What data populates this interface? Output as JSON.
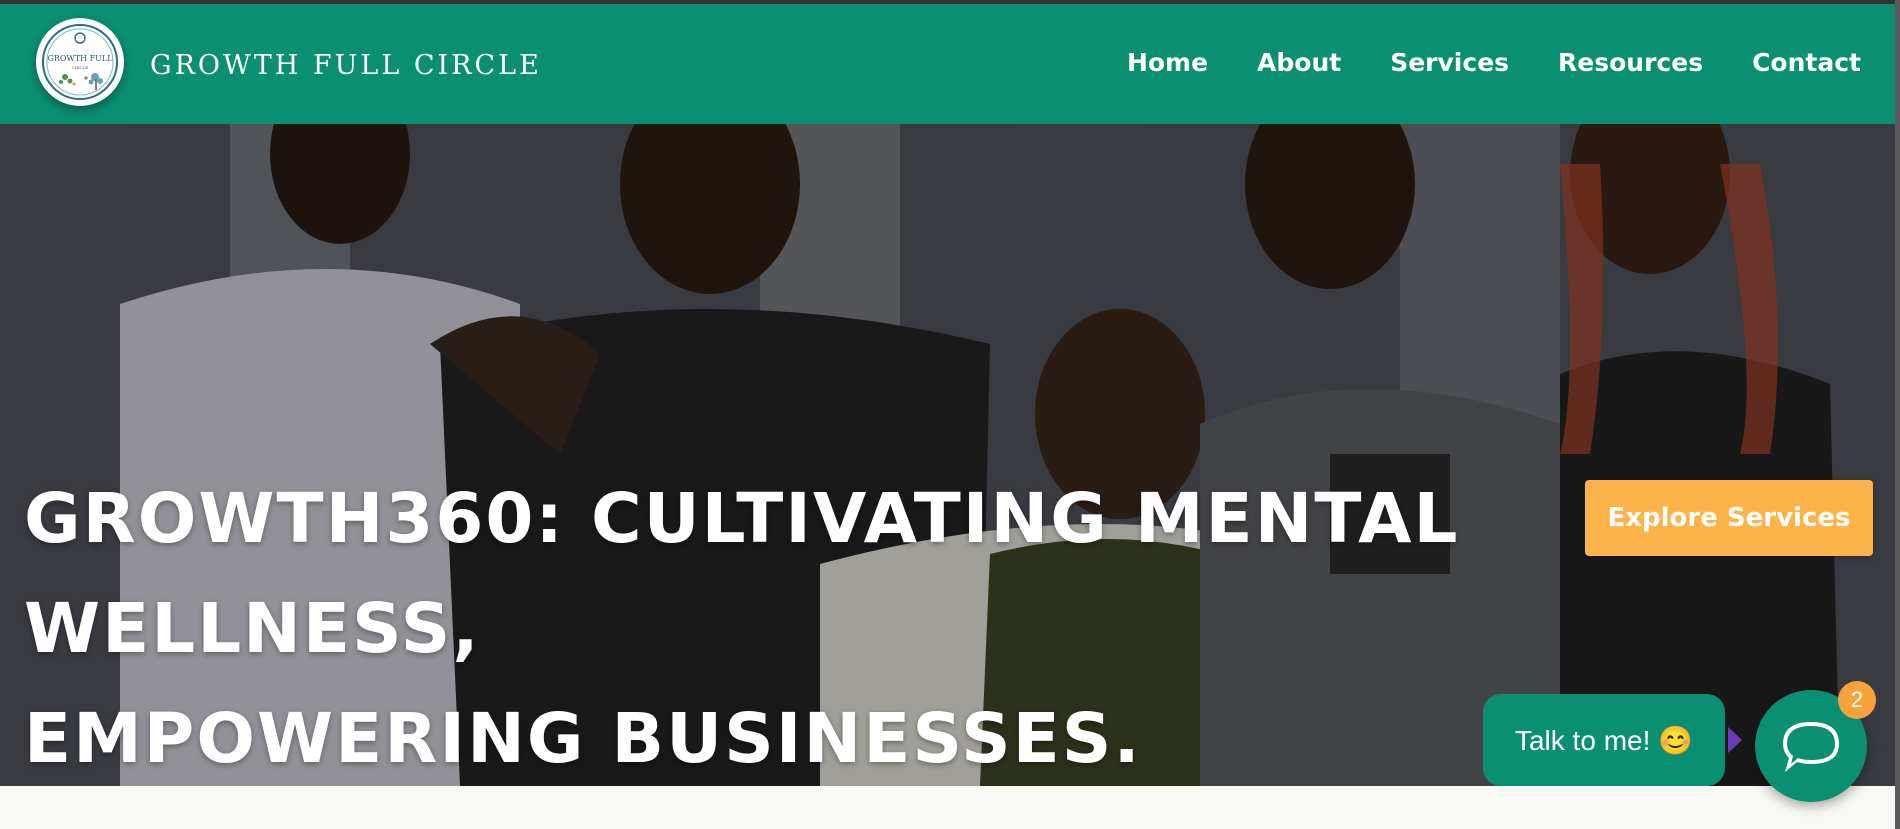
{
  "header": {
    "brand": "GROWTH FULL CIRCLE",
    "logo_icon": "growth-full-circle-logo",
    "logo_text": "GROWTH FULL",
    "logo_subtext": "CIRCLE",
    "nav": [
      "Home",
      "About",
      "Services",
      "Resources",
      "Contact"
    ]
  },
  "hero": {
    "headline_line1": "GROWTH360: CULTIVATING MENTAL WELLNESS,",
    "headline_line2": "EMPOWERING BUSINESSES.",
    "cta_label": "Explore Services",
    "background_image": "group of cheering people"
  },
  "chat": {
    "bubble_text": "Talk to me! 😊",
    "badge_count": "2",
    "launcher_icon": "chat-icon"
  },
  "colors": {
    "primary": "#0b8f72",
    "accent": "#fbb34a",
    "badge": "#f7a23b",
    "text": "#ffffff"
  }
}
